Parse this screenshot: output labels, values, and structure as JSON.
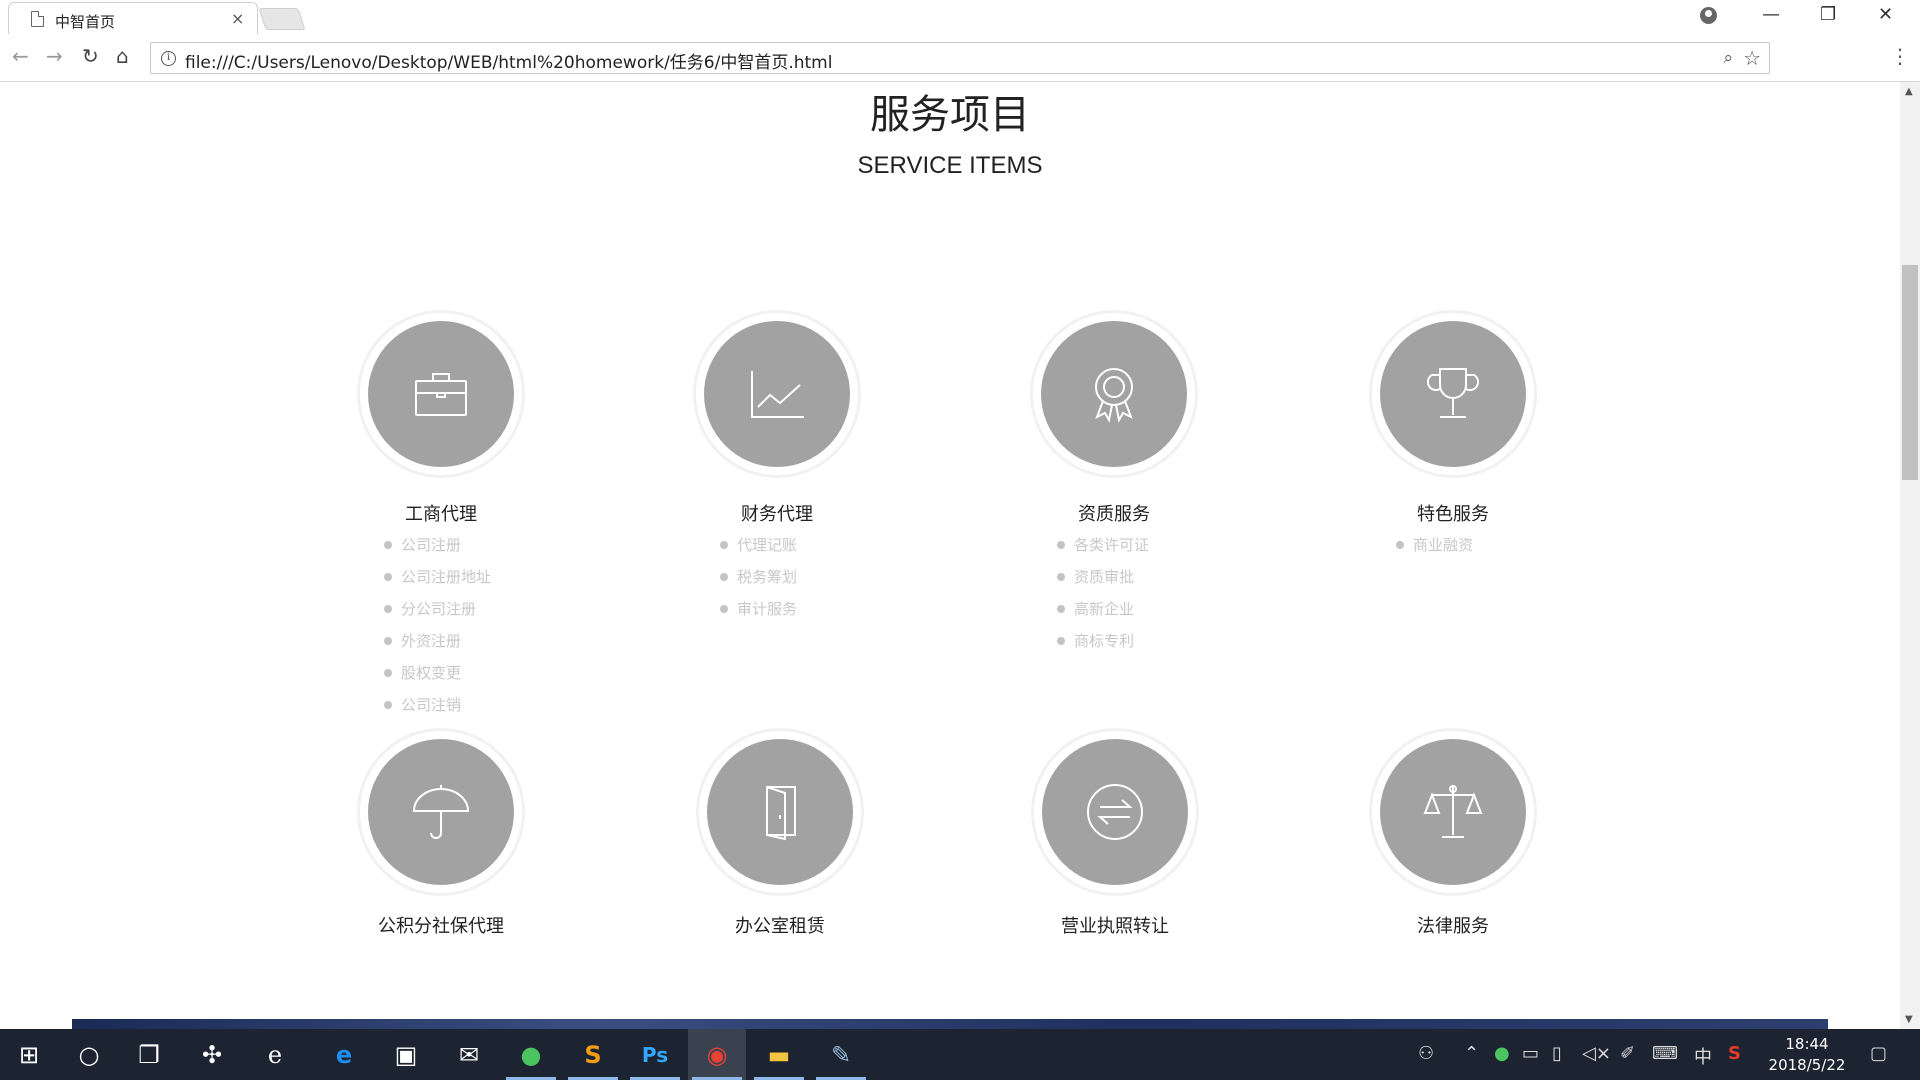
{
  "browser": {
    "tab_title": "中智首页",
    "tab_close": "×",
    "url": "file:///C:/Users/Lenovo/Desktop/WEB/html%20homework/任务6/中智首页.html",
    "controls": {
      "minimize": "—",
      "restore": "❐",
      "close": "✕"
    },
    "nav": {
      "back": "←",
      "forward": "→",
      "reload": "↻",
      "home": "⌂"
    },
    "info_glyph": "i",
    "zoom_glyph": "⌕",
    "star_glyph": "☆",
    "menu_glyph": "⋮"
  },
  "page": {
    "title": "服务项目",
    "subtitle": "SERVICE ITEMS",
    "services": [
      {
        "name": "工商代理",
        "icon": "briefcase-icon",
        "items": [
          "公司注册",
          "公司注册地址",
          "分公司注册",
          "外资注册",
          "股权变更",
          "公司注销"
        ]
      },
      {
        "name": "财务代理",
        "icon": "line-chart-icon",
        "items": [
          "代理记账",
          "税务筹划",
          "审计服务"
        ]
      },
      {
        "name": "资质服务",
        "icon": "award-medal-icon",
        "items": [
          "各类许可证",
          "资质审批",
          "高新企业",
          "商标专利"
        ]
      },
      {
        "name": "特色服务",
        "icon": "trophy-icon",
        "items": [
          "商业融资"
        ]
      },
      {
        "name": "公积分社保代理",
        "icon": "umbrella-icon",
        "items": []
      },
      {
        "name": "办公室租赁",
        "icon": "door-icon",
        "items": []
      },
      {
        "name": "营业执照转让",
        "icon": "transfer-arrows-icon",
        "items": []
      },
      {
        "name": "法律服务",
        "icon": "scales-icon",
        "items": []
      }
    ]
  },
  "taskbar": {
    "start_glyph": "⊞",
    "cortana_glyph": "○",
    "taskview_glyph": "❐",
    "apps": [
      "pinwheel-app-icon",
      "ie-icon",
      "edge-icon",
      "store-icon",
      "mail-icon",
      "360-browser-icon",
      "sublime-text-icon",
      "photoshop-icon",
      "chrome-icon",
      "file-explorer-icon",
      "paint-icon"
    ],
    "app_labels": {
      "photoshop": "Ps",
      "sublime": "S"
    },
    "ime": "中",
    "time": "18:44",
    "date": "2018/5/22"
  }
}
